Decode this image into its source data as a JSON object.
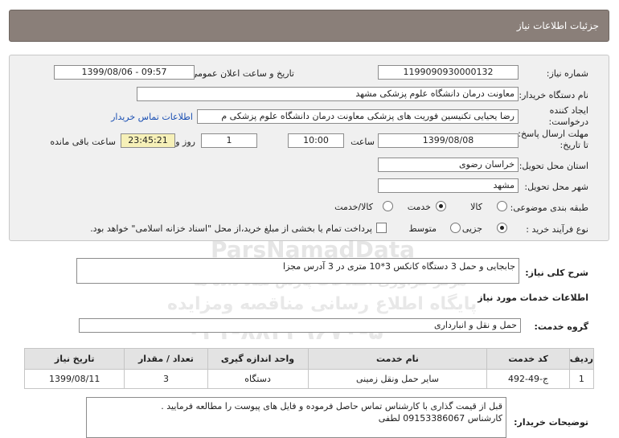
{
  "header": {
    "title": "جزئیات اطلاعات نیاز"
  },
  "form": {
    "need_number_label": "شماره نیاز:",
    "need_number": "1199090930000132",
    "announce_label": "تاریخ و ساعت اعلان عمومی:",
    "announce_value": "1399/08/06 - 09:57",
    "buyer_label": "نام دستگاه خریدار:",
    "buyer_value": "معاونت درمان دانشگاه علوم پزشکی مشهد",
    "creator_label_1": "ایجاد کننده",
    "creator_label_2": "درخواست:",
    "creator_value": "رضا یحیایی تکنیسین فوریت های پزشکی معاونت درمان دانشگاه علوم پزشکی م",
    "contact_link": "اطلاعات تماس خریدار",
    "deadline_label_1": "مهلت ارسال پاسخ:",
    "deadline_label_2": "تا تاریخ:",
    "deadline_date": "1399/08/08",
    "time_label": "ساعت",
    "deadline_time": "10:00",
    "days_value": "1",
    "days_label": "روز و",
    "remaining_value": "23:45:21",
    "remaining_label": "ساعت باقی مانده",
    "province_label": "استان محل تحویل:",
    "province_value": "خراسان رضوی",
    "city_label": "شهر محل تحویل:",
    "city_value": "مشهد",
    "category_label": "طبقه بندی موضوعی:",
    "category_options": [
      "کالا",
      "خدمت",
      "کالا/خدمت"
    ],
    "category_selected": "خدمت",
    "process_label": "نوع فرآیند خرید :",
    "process_options": [
      "جزیی",
      "متوسط"
    ],
    "process_selected": "جزیی",
    "payment_note": "پرداخت تمام یا بخشی از مبلغ خرید،از محل \"اسناد خزانه اسلامی\" خواهد بود."
  },
  "summary": {
    "label": "شرح کلی نیاز:",
    "value": "جابجایی و حمل 3 دستگاه کانکس 3*10 متری در 3 آدرس مجزا"
  },
  "services": {
    "section_title": "اطلاعات خدمات مورد نیاز",
    "group_label": "گروه خدمت:",
    "group_value": "حمل و نقل و انبارداری",
    "columns": [
      "ردیف",
      "کد خدمت",
      "نام خدمت",
      "واحد اندازه گیری",
      "تعداد / مقدار",
      "تاریخ نیاز"
    ],
    "rows": [
      [
        "1",
        "ج-49-492",
        "سایر حمل ونقل زمینی",
        "دستگاه",
        "3",
        "1399/08/11"
      ]
    ]
  },
  "buyer_notes": {
    "label": "توضیحات خریدار:",
    "line1": "قبل از قیمت گذاری با کارشناس تماس حاصل فرموده و فایل های پیوست را مطالعه فرمایید .",
    "line2": "کارشناس 09153386067 لطفی"
  },
  "watermark": {
    "line1": "ParsNamadData",
    "line2": "مرکز فراوری اطلاعات پارس نماد داده ها",
    "line3": "پایگاه اطلاع رسانی مناقصه ومزایده",
    "line4": "۰۲۱-۸۸۳۴۹۶۷۰-۵"
  },
  "colors": {
    "header_bg": "#8a7f79",
    "panel_bg": "#f0f0f0",
    "link": "#1a4fb3",
    "remaining_bg": "#f6f0b8"
  }
}
